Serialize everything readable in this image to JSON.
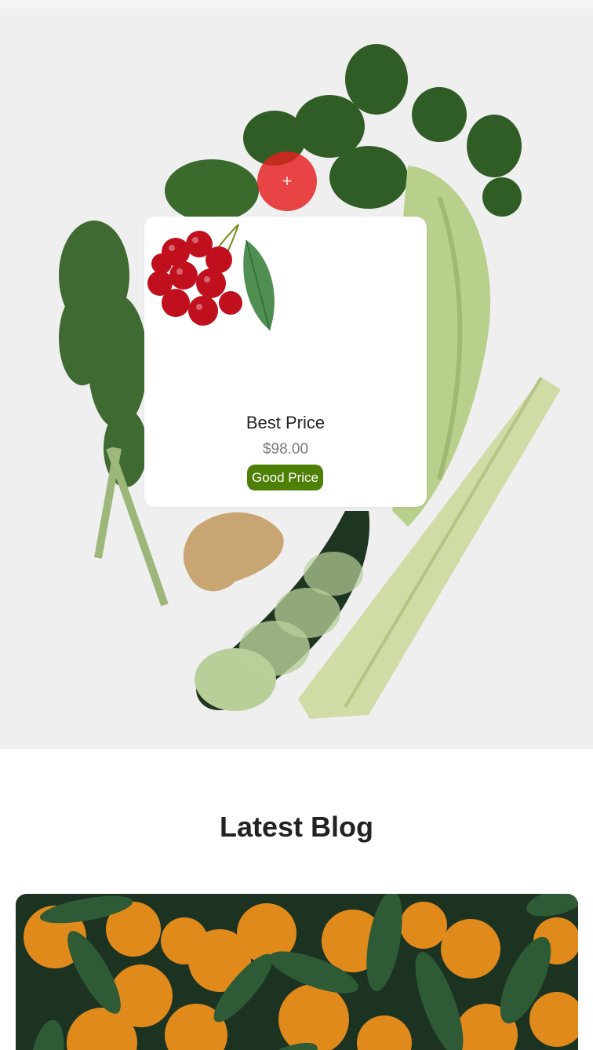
{
  "hero": {
    "hotspot_icon": "+"
  },
  "product_card": {
    "image_icon": "cherries-image",
    "name": "Best Price",
    "price": "$98.00",
    "badge": "Good Price",
    "badge_color": "#4e7f07",
    "hotspot_color": "#e61e1e"
  },
  "blog": {
    "section_title": "Latest Blog",
    "card_image_icon": "oranges-with-leaves-image"
  }
}
